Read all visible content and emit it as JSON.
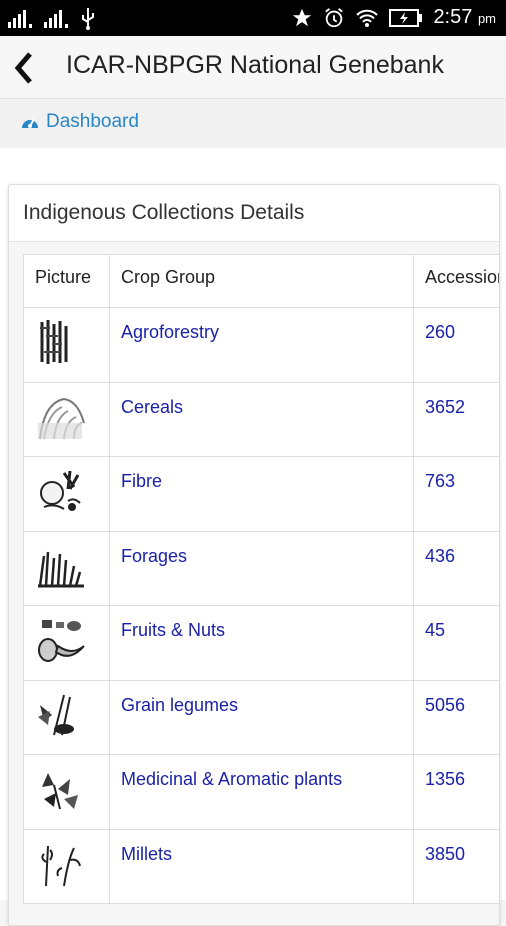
{
  "status_bar": {
    "time": "2:57",
    "ampm": "pm",
    "icons": [
      "signal-icon",
      "signal-icon",
      "usb-icon",
      "star-icon",
      "alarm-icon",
      "wifi-icon",
      "battery-icon"
    ]
  },
  "app_bar": {
    "title": "ICAR-NBPGR National Genebank",
    "back_icon": "chevron-left-icon"
  },
  "breadcrumb": {
    "icon": "dashboard-icon",
    "label": "Dashboard"
  },
  "card": {
    "title": "Indigenous Collections Details",
    "columns": [
      "Picture",
      "Crop Group",
      "Accessions"
    ],
    "rows": [
      {
        "icon": "agroforestry-icon",
        "group": "Agroforestry",
        "accessions": "260"
      },
      {
        "icon": "cereals-icon",
        "group": "Cereals",
        "accessions": "3652"
      },
      {
        "icon": "fibre-icon",
        "group": "Fibre",
        "accessions": "763"
      },
      {
        "icon": "forages-icon",
        "group": "Forages",
        "accessions": "436"
      },
      {
        "icon": "fruits-nuts-icon",
        "group": "Fruits & Nuts",
        "accessions": "45"
      },
      {
        "icon": "grain-legumes-icon",
        "group": "Grain legumes",
        "accessions": "5056"
      },
      {
        "icon": "medicinal-icon",
        "group": "Medicinal & Aromatic plants",
        "accessions": "1356"
      },
      {
        "icon": "millets-icon",
        "group": "Millets",
        "accessions": "3850"
      }
    ]
  },
  "colors": {
    "link": "#1a22a8",
    "breadcrumb": "#2a87c5",
    "status_bar_bg": "#000000"
  }
}
